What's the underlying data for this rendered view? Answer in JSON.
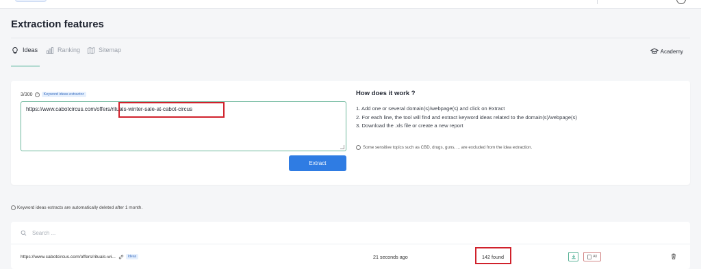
{
  "page": {
    "title": "Extraction features"
  },
  "tabs": [
    {
      "label": "Ideas",
      "icon": "lightbulb-icon",
      "active": true
    },
    {
      "label": "Ranking",
      "icon": "bar-chart-icon",
      "active": false
    },
    {
      "label": "Sitemap",
      "icon": "map-icon",
      "active": false
    }
  ],
  "academy": {
    "label": "Academy",
    "icon": "graduation-cap-icon"
  },
  "extractor": {
    "counter": "3/300",
    "tag": "Keyword ideas extractor",
    "input_value": "https://www.cabotcircus.com/offers/rituals-winter-sale-at-cabot-circus",
    "button_label": "Extract"
  },
  "how": {
    "title": "How does it work ?",
    "steps": [
      "1. Add one or several domain(s)/webpage(s) and click on Extract",
      "2. For each line, the tool will find and extract keyword ideas related to the domain(s)/webpage(s)",
      "3. Download the .xls file or create a new report"
    ],
    "note": "Some sensitive topics such as CBD, drugs, guns, ... are excluded from the idea extraction."
  },
  "retention_notice": "Keyword ideas extracts are automatically deleted after 1 month.",
  "search": {
    "placeholder": "Search ..."
  },
  "results": [
    {
      "url": "https://www.cabotcircus.com/offers/rituals-wi...",
      "tag": "Ideas",
      "time": "21 seconds ago",
      "found": "142 found",
      "all_label": "All"
    }
  ],
  "colors": {
    "accent": "#3aa78a",
    "primary_button": "#2f7ce3",
    "annotation": "#d0212b"
  }
}
